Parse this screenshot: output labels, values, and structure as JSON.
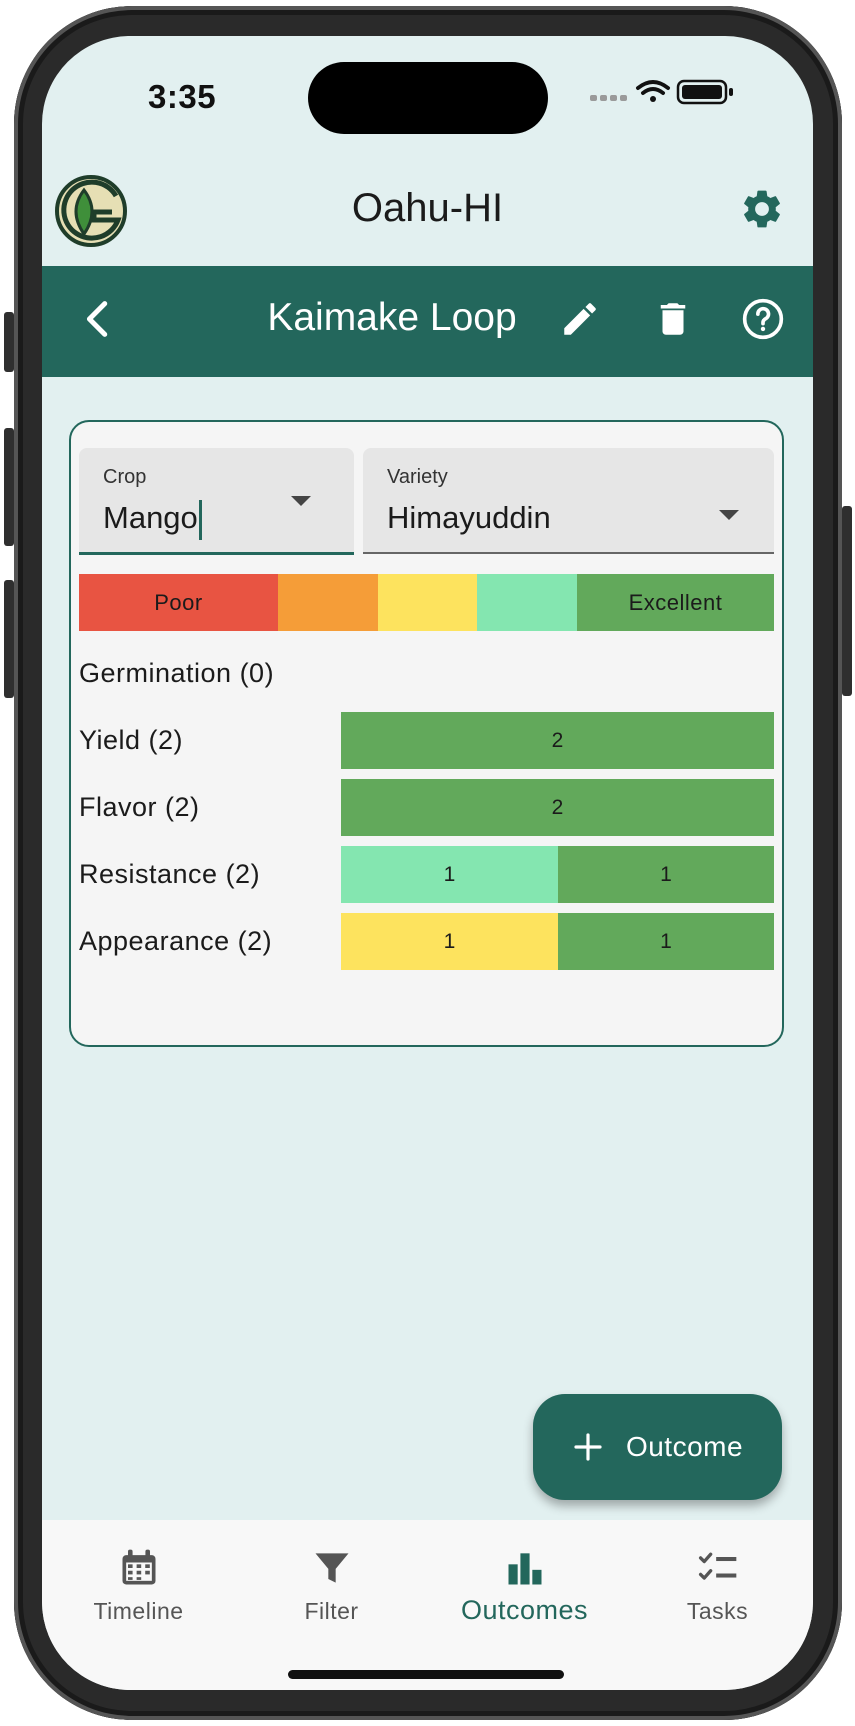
{
  "status_bar": {
    "time": "3:35"
  },
  "header": {
    "location_title": "Oahu-HI"
  },
  "navbar": {
    "title": "Kaimake Loop"
  },
  "filters": {
    "crop": {
      "label": "Crop",
      "value": "Mango"
    },
    "variety": {
      "label": "Variety",
      "value": "Himayuddin"
    }
  },
  "legend": {
    "poor": "Poor",
    "excellent": "Excellent",
    "colors": [
      "#e85442",
      "#f59d38",
      "#fde35e",
      "#84e6b0",
      "#62a95b"
    ]
  },
  "ratings": [
    {
      "label": "Germination (0)",
      "segments": []
    },
    {
      "label": "Yield (2)",
      "segments": [
        {
          "count": "2",
          "color": "#62a95b"
        }
      ]
    },
    {
      "label": "Flavor (2)",
      "segments": [
        {
          "count": "2",
          "color": "#62a95b"
        }
      ]
    },
    {
      "label": "Resistance (2)",
      "segments": [
        {
          "count": "1",
          "color": "#84e6b0"
        },
        {
          "count": "1",
          "color": "#62a95b"
        }
      ]
    },
    {
      "label": "Appearance (2)",
      "segments": [
        {
          "count": "1",
          "color": "#fde35e"
        },
        {
          "count": "1",
          "color": "#62a95b"
        }
      ]
    }
  ],
  "fab": {
    "label": "Outcome",
    "icon": "plus-icon"
  },
  "bottom_nav": {
    "items": [
      {
        "label": "Timeline",
        "icon": "calendar-icon"
      },
      {
        "label": "Filter",
        "icon": "funnel-icon"
      },
      {
        "label": "Outcomes",
        "icon": "bar-chart-icon",
        "active": true
      },
      {
        "label": "Tasks",
        "icon": "checklist-icon"
      }
    ]
  },
  "colors": {
    "primary": "#23675c",
    "background": "#e2f0f0",
    "card": "#f5f5f5"
  }
}
